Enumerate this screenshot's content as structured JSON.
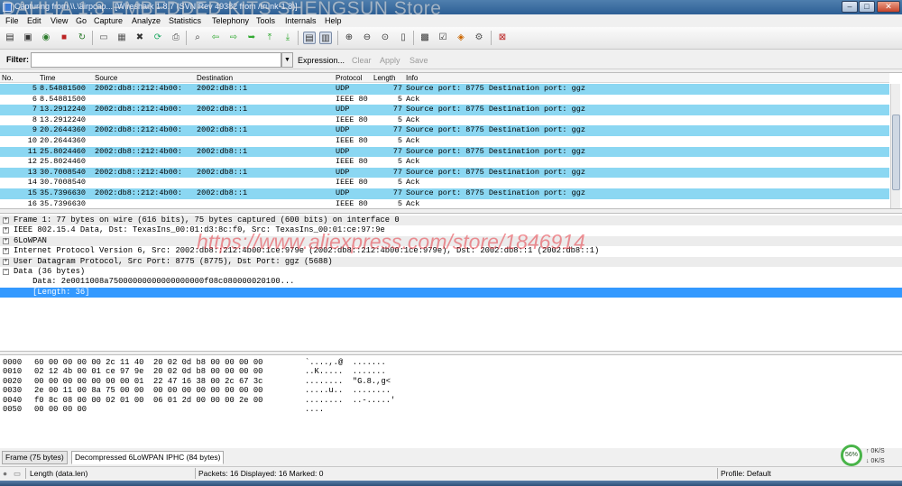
{
  "window": {
    "title": "Capturing from \\\\.\\airpcap... [Wireshark 1.8.7 (SVN Rev 49382 from /trunk-1.8)]",
    "watermark": "DAHLIA 1.8 EMBEDDED KITS SHENGSUN Store",
    "minimize_label": "–",
    "maximize_label": "□",
    "close_label": "✕"
  },
  "menu": [
    "File",
    "Edit",
    "View",
    "Go",
    "Capture",
    "Analyze",
    "Statistics",
    "Telephony",
    "Tools",
    "Internals",
    "Help"
  ],
  "filter": {
    "label": "Filter:",
    "value": "",
    "buttons": {
      "expression": "Expression...",
      "clear": "Clear",
      "apply": "Apply",
      "save": "Save"
    }
  },
  "packet_list": {
    "columns": [
      "No.",
      "Time",
      "Source",
      "Destination",
      "Protocol",
      "Length",
      "Info"
    ],
    "rows": [
      {
        "no": "5",
        "time": "8.54881500",
        "src": "2002:db8::212:4b00:",
        "dst": "2002:db8::1",
        "proto": "UDP",
        "len": "77",
        "info": "Source port: 8775  Destination port: ggz",
        "kind": "udp"
      },
      {
        "no": "6",
        "time": "8.54881500",
        "src": "",
        "dst": "",
        "proto": "IEEE 80",
        "len": "5",
        "info": "Ack",
        "kind": "ieee"
      },
      {
        "no": "7",
        "time": "13.2912240",
        "src": "2002:db8::212:4b00:",
        "dst": "2002:db8::1",
        "proto": "UDP",
        "len": "77",
        "info": "Source port: 8775  Destination port: ggz",
        "kind": "udp"
      },
      {
        "no": "8",
        "time": "13.2912240",
        "src": "",
        "dst": "",
        "proto": "IEEE 80",
        "len": "5",
        "info": "Ack",
        "kind": "ieee"
      },
      {
        "no": "9",
        "time": "20.2644360",
        "src": "2002:db8::212:4b00:",
        "dst": "2002:db8::1",
        "proto": "UDP",
        "len": "77",
        "info": "Source port: 8775  Destination port: ggz",
        "kind": "udp"
      },
      {
        "no": "10",
        "time": "20.2644360",
        "src": "",
        "dst": "",
        "proto": "IEEE 80",
        "len": "5",
        "info": "Ack",
        "kind": "ieee"
      },
      {
        "no": "11",
        "time": "25.8024460",
        "src": "2002:db8::212:4b00:",
        "dst": "2002:db8::1",
        "proto": "UDP",
        "len": "77",
        "info": "Source port: 8775  Destination port: ggz",
        "kind": "udp"
      },
      {
        "no": "12",
        "time": "25.8024460",
        "src": "",
        "dst": "",
        "proto": "IEEE 80",
        "len": "5",
        "info": "Ack",
        "kind": "ieee"
      },
      {
        "no": "13",
        "time": "30.7008540",
        "src": "2002:db8::212:4b00:",
        "dst": "2002:db8::1",
        "proto": "UDP",
        "len": "77",
        "info": "Source port: 8775  Destination port: ggz",
        "kind": "udp"
      },
      {
        "no": "14",
        "time": "30.7008540",
        "src": "",
        "dst": "",
        "proto": "IEEE 80",
        "len": "5",
        "info": "Ack",
        "kind": "ieee"
      },
      {
        "no": "15",
        "time": "35.7396630",
        "src": "2002:db8::212:4b00:",
        "dst": "2002:db8::1",
        "proto": "UDP",
        "len": "77",
        "info": "Source port: 8775  Destination port: ggz",
        "kind": "udp"
      },
      {
        "no": "16",
        "time": "35.7396630",
        "src": "",
        "dst": "",
        "proto": "IEEE 80",
        "len": "5",
        "info": "Ack",
        "kind": "ieee"
      }
    ]
  },
  "details": {
    "rows": [
      {
        "text": "Frame 1: 77 bytes on wire (616 bits), 75 bytes captured (600 bits) on interface 0",
        "expander": "+",
        "style": "grey"
      },
      {
        "text": "IEEE 802.15.4 Data, Dst: TexasIns_00:01:d3:8c:f0, Src: TexasIns_00:01:ce:97:9e",
        "expander": "+",
        "style": "plain"
      },
      {
        "text": "6LoWPAN",
        "expander": "+",
        "style": "grey"
      },
      {
        "text": "Internet Protocol Version 6, Src: 2002:db8::212:4b00:1ce:979e (2002:db8::212:4b00:1ce:979e), Dst: 2002:db8::1 (2002:db8::1)",
        "expander": "+",
        "style": "plain"
      },
      {
        "text": "User Datagram Protocol, Src Port: 8775 (8775), Dst Port: ggz (5688)",
        "expander": "+",
        "style": "grey"
      },
      {
        "text": "Data (36 bytes)",
        "expander": "−",
        "style": "plain"
      },
      {
        "text": "    Data: 2e0011008a75000000000000000000f08c080000020100...",
        "expander": "",
        "style": "plain"
      },
      {
        "text": "    [Length: 36]",
        "expander": "",
        "style": "sel"
      }
    ],
    "watermark": "https://www.aliexpress.com/store/1846914"
  },
  "bytes": {
    "rows": [
      {
        "offset": "0000",
        "hex": "60 00 00 00 00 2c 11 40  20 02 0d b8 00 00 00 00",
        "ascii": "`....,.@  ......."
      },
      {
        "offset": "0010",
        "hex": "02 12 4b 00 01 ce 97 9e  20 02 0d b8 00 00 00 00",
        "ascii": "..K.....  ......."
      },
      {
        "offset": "0020",
        "hex": "00 00 00 00 00 00 00 01  22 47 16 38 00 2c 67 3c",
        "ascii": "........  \"G.8.,g<"
      },
      {
        "offset": "0030",
        "hex": "2e 00 11 00 8a 75 00 00  00 00 00 00 00 00 00 00",
        "ascii": ".....u..  ........"
      },
      {
        "offset": "0040",
        "hex": "f0 8c 08 00 00 02 01 00  06 01 2d 00 00 00 2e 00",
        "ascii": "........  ..-.....'"
      },
      {
        "offset": "0050",
        "hex": "00 00 00 00",
        "ascii": "...."
      }
    ]
  },
  "tabs": [
    "Frame (75 bytes)",
    "Decompressed 6LoWPAN IPHC (84 bytes)"
  ],
  "status": {
    "field": "Length (data.len)",
    "packets": "Packets: 16 Displayed: 16 Marked: 0",
    "profile": "Profile: Default"
  },
  "gauge": {
    "percent": "56%",
    "up": "0K/S",
    "down": "0K/S"
  },
  "colors": {
    "udp_row": "#8bd7f2",
    "selected": "#3399ff"
  }
}
